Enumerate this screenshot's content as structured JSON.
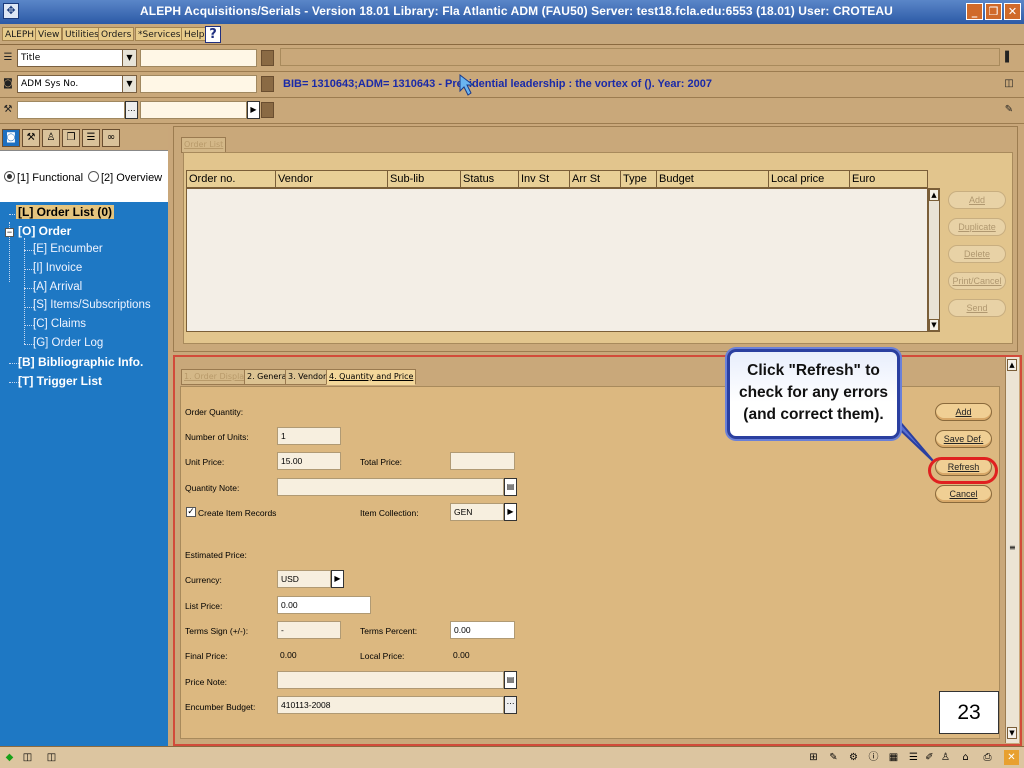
{
  "window": {
    "title": "ALEPH Acquisitions/Serials - Version 18.01  Library:  Fla Atlantic ADM (FAU50)  Server:  test18.fcla.edu:6553 (18.01)  User:  CROTEAU"
  },
  "menu": {
    "items": [
      "ALEPH",
      "View",
      "Utilities",
      "Orders",
      "*Services",
      "Help"
    ],
    "help_q": "?"
  },
  "search": {
    "row1_index": "Title",
    "row2_index": "ADM Sys No.",
    "record_info": "BIB= 1310643;ADM= 1310643 - Presidential leadership : the vortex of (). Year: 2007"
  },
  "left": {
    "mode_functional": "[1] Functional",
    "mode_overview": "[2] Overview",
    "tree": {
      "order_list": "[L] Order List (0)",
      "order": "[O] Order",
      "encumber": "[E] Encumber",
      "invoice": "[I] Invoice",
      "arrival": "[A] Arrival",
      "items_subs": "[S] Items/Subscriptions",
      "claims": "[C] Claims",
      "order_log": "[G] Order Log",
      "biblio": "[B] Bibliographic Info.",
      "trigger": "[T] Trigger List"
    }
  },
  "upper": {
    "tab": "Order List",
    "columns": [
      "Order no.",
      "Vendor",
      "Sub-lib",
      "Status",
      "Inv St",
      "Arr St",
      "Type",
      "Budget",
      "Local price",
      "Euro"
    ],
    "buttons": {
      "add": "Add",
      "duplicate": "Duplicate",
      "delete": "Delete",
      "print_cancel": "Print/Cancel",
      "send": "Send"
    }
  },
  "lower": {
    "tabs": [
      "1. Order Display",
      "2. General",
      "3. Vendor",
      "4. Quantity and Price"
    ],
    "form": {
      "order_quantity_label": "Order Quantity:",
      "number_of_units_label": "Number of Units:",
      "number_of_units": "1",
      "unit_price_label": "Unit Price:",
      "unit_price": "15.00",
      "total_price_label": "Total Price:",
      "total_price": "",
      "quantity_note_label": "Quantity Note:",
      "quantity_note": "",
      "create_item_records_label": "Create Item Records",
      "item_collection_label": "Item Collection:",
      "item_collection": "GEN",
      "estimated_price_label": "Estimated Price:",
      "currency_label": "Currency:",
      "currency": "USD",
      "list_price_label": "List Price:",
      "list_price": "0.00",
      "terms_sign_label": "Terms Sign (+/-):",
      "terms_sign": "-",
      "terms_percent_label": "Terms Percent:",
      "terms_percent": "0.00",
      "final_price_label": "Final Price:",
      "final_price": "0.00",
      "local_price_label": "Local Price:",
      "local_price": "0.00",
      "price_note_label": "Price Note:",
      "price_note": "",
      "encumber_budget_label": "Encumber Budget:",
      "encumber_budget": "410113-2008"
    },
    "buttons": {
      "add": "Add",
      "save_def": "Save Def.",
      "refresh": "Refresh",
      "cancel": "Cancel"
    }
  },
  "callout": {
    "line1": "Click \"Refresh\" to",
    "line2": "check for any errors",
    "line3": "(and correct them)."
  },
  "slide_number": "23"
}
